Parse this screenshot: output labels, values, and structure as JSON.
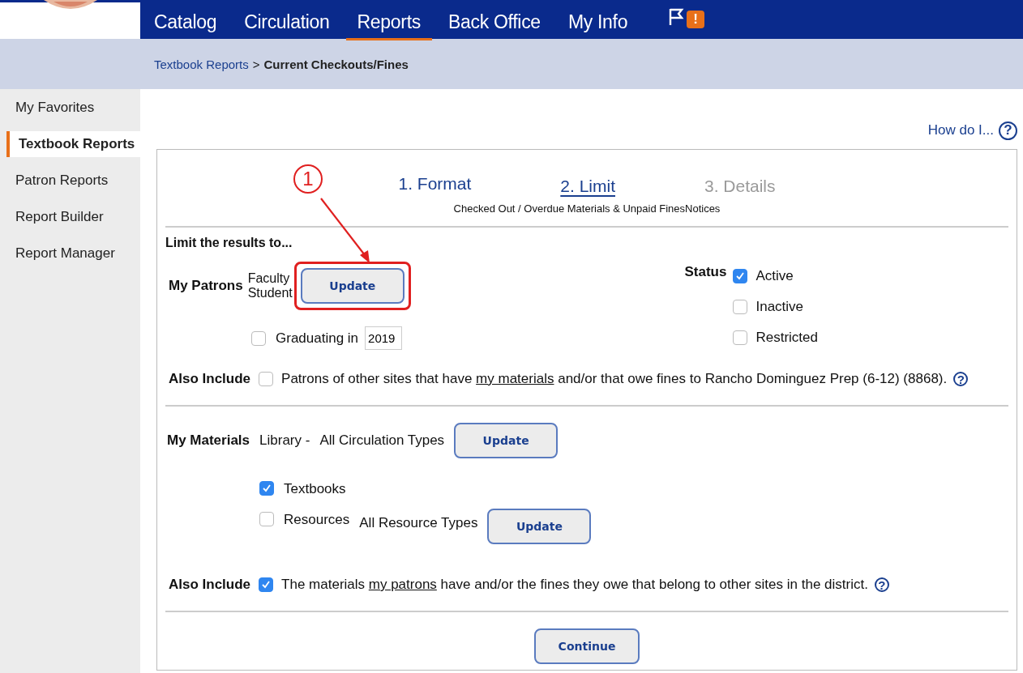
{
  "nav": {
    "items": [
      {
        "label": "Catalog",
        "selected": false
      },
      {
        "label": "Circulation",
        "selected": false
      },
      {
        "label": "Reports",
        "selected": true
      },
      {
        "label": "Back Office",
        "selected": false
      },
      {
        "label": "My Info",
        "selected": false
      }
    ],
    "alert_badge": "!"
  },
  "breadcrumb": {
    "link": "Textbook Reports",
    "separator": ">",
    "current": "Current Checkouts/Fines"
  },
  "sidebar": {
    "items": [
      {
        "label": "My Favorites",
        "selected": false
      },
      {
        "label": "Textbook Reports",
        "selected": true
      },
      {
        "label": "Patron Reports",
        "selected": false
      },
      {
        "label": "Report Builder",
        "selected": false
      },
      {
        "label": "Report Manager",
        "selected": false
      }
    ]
  },
  "help": {
    "label": "How do I...",
    "icon": "?"
  },
  "steps": [
    {
      "label": "1. Format",
      "selected": false,
      "disabled": false
    },
    {
      "label": "2. Limit",
      "selected": true,
      "disabled": false
    },
    {
      "label": "3. Details",
      "selected": false,
      "disabled": true
    }
  ],
  "subtitle": "Checked Out / Overdue Materials & Unpaid FinesNotices",
  "heading": "Limit the results to...",
  "patrons": {
    "label": "My Patrons",
    "types": [
      "Faculty",
      "Student"
    ],
    "button": "Update",
    "highlighted": true,
    "graduating": {
      "label": "Graduating in",
      "checked": false,
      "value": "2019"
    }
  },
  "status": {
    "label": "Status",
    "options": [
      {
        "label": "Active",
        "checked": true
      },
      {
        "label": "Inactive",
        "checked": false
      },
      {
        "label": "Restricted",
        "checked": false
      }
    ]
  },
  "also_include_patrons": {
    "label": "Also Include",
    "checked": false,
    "before": "Patrons of other sites that have",
    "link": "my materials",
    "after": "and/or that owe fines to Rancho Dominguez Prep (6-12) (8868).",
    "help_icon": "?"
  },
  "materials": {
    "label": "My Materials",
    "library": "Library -",
    "types": "All Circulation Types",
    "button": "Update",
    "options": [
      {
        "label": "Textbooks",
        "checked": true
      },
      {
        "label": "Resources",
        "checked": false,
        "types": "All Resource Types",
        "button": "Update"
      }
    ]
  },
  "also_include_materials": {
    "label": "Also Include",
    "checked": true,
    "before": "The materials",
    "link": "my patrons",
    "after": "have and/or the fines they owe that belong to other sites in the district.",
    "help_icon": "?"
  },
  "continue_button": "Continue",
  "annotation": {
    "number": "1"
  }
}
